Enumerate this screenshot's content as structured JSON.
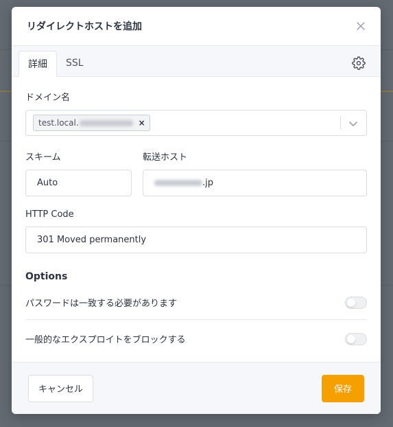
{
  "modal": {
    "title": "リダイレクトホストを追加"
  },
  "tabs": [
    {
      "label": "詳細",
      "active": true
    },
    {
      "label": "SSL",
      "active": false
    }
  ],
  "domain": {
    "label": "ドメイン名",
    "chips": [
      {
        "visible_text": "test.local.",
        "redacted": true
      }
    ]
  },
  "scheme": {
    "label": "スキーム",
    "value": "Auto"
  },
  "forward_host": {
    "label": "転送ホスト",
    "visible_suffix": ".jp",
    "redacted_prefix": true
  },
  "http_code": {
    "label": "HTTP Code",
    "value": "301 Moved permanently"
  },
  "options": {
    "title": "Options",
    "items": [
      {
        "label": "パスワードは一致する必要があります",
        "enabled": false
      },
      {
        "label": "一般的なエクスプロイトをブロックする",
        "enabled": false
      }
    ]
  },
  "footer": {
    "cancel_label": "キャンセル",
    "save_label": "保存"
  },
  "colors": {
    "primary": "#f59f00",
    "text": "#2b3340",
    "border": "#d9dde2",
    "overlay": "#636a72"
  },
  "icons": {
    "close": "close-icon",
    "settings": "gear-icon",
    "dropdown": "chevron-down-icon"
  }
}
